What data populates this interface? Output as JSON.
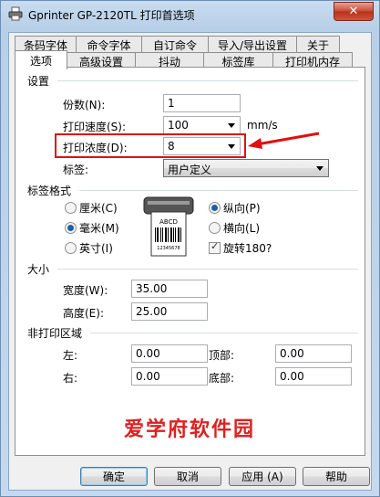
{
  "window": {
    "title": "Gprinter  GP-2120TL 打印首选项",
    "close_icon": "close-icon"
  },
  "tabs": {
    "row1": [
      "条码字体",
      "命令字体",
      "自订命令",
      "导入/导出设置",
      "关于"
    ],
    "row2": [
      "选项",
      "高级设置",
      "抖动",
      "标签库",
      "打印机内存"
    ],
    "selected": "选项"
  },
  "settings": {
    "group_label": "设置",
    "copies_label": "份数(N):",
    "copies_value": "1",
    "speed_label": "打印速度(S):",
    "speed_value": "100",
    "speed_unit": "mm/s",
    "darkness_label": "打印浓度(D):",
    "darkness_value": "8",
    "stock_label": "标签:",
    "stock_value": "用户定义"
  },
  "format": {
    "group_label": "标签格式",
    "unit_cm": "厘米(C)",
    "unit_mm": "毫米(M)",
    "unit_inch": "英寸(I)",
    "selected_unit": "毫米(M)",
    "portrait": "纵向(P)",
    "landscape": "横向(L)",
    "selected_orientation": "纵向(P)",
    "rotate": "旋转180?",
    "rotate_checked": true,
    "preview_label": "ABCD",
    "preview_barcode_text": "12345678"
  },
  "size": {
    "group_label": "大小",
    "width_label": "宽度(W):",
    "width_value": "35.00",
    "height_label": "高度(E):",
    "height_value": "25.00"
  },
  "margins": {
    "group_label": "非打印区域",
    "left_label": "左:",
    "left_value": "0.00",
    "top_label": "顶部:",
    "top_value": "0.00",
    "right_label": "右:",
    "right_value": "0.00",
    "bottom_label": "底部:",
    "bottom_value": "0.00"
  },
  "watermark": "爱学府软件园",
  "buttons": {
    "ok": "确定",
    "cancel": "取消",
    "apply": "应用 (A)",
    "help": "帮助"
  },
  "colors": {
    "highlight": "#e01010",
    "watermark": "#e02020"
  }
}
